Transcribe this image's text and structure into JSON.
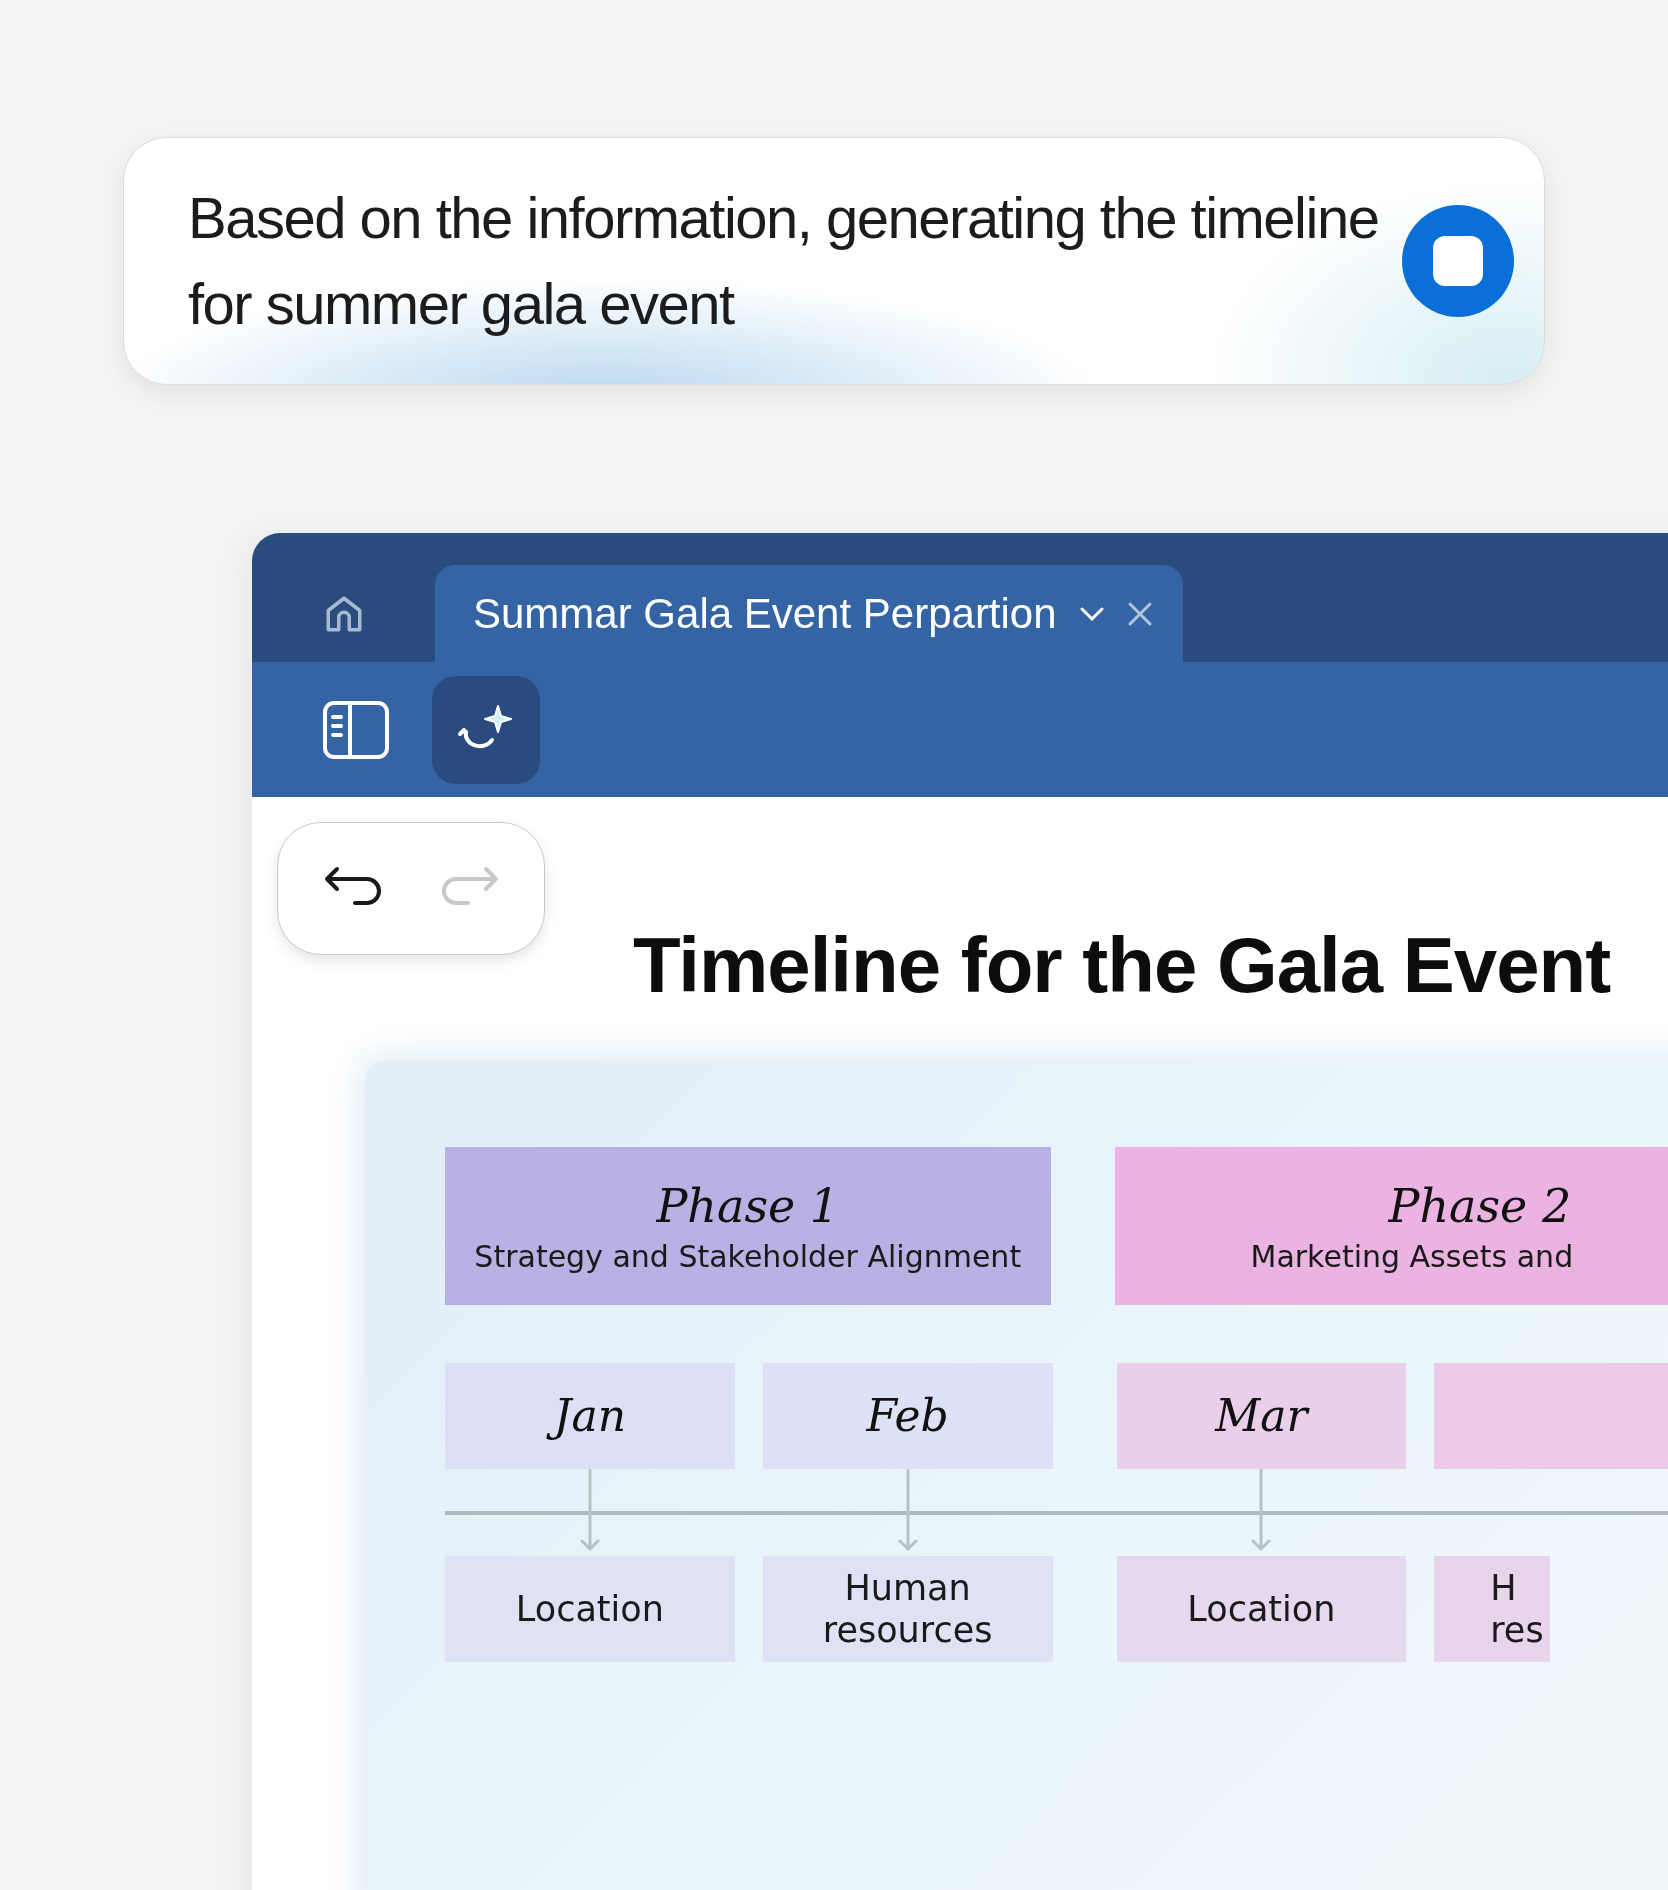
{
  "prompt": {
    "text": "Based on the information, generating the timeline for summer gala event",
    "generating": true
  },
  "tabs": [
    {
      "label": "Summar Gala Event Perpartion",
      "selected": true
    }
  ],
  "history": {
    "undo_disabled": false,
    "redo_disabled": true
  },
  "document": {
    "title": "Timeline for the Gala Event"
  },
  "timeline": {
    "phases": [
      {
        "title": "Phase 1",
        "subtitle": "Strategy and Stakeholder Alignment",
        "color": "#b8b1e3"
      },
      {
        "title": "Phase 2",
        "subtitle": "Marketing Assets and",
        "color": "#eab3e1"
      }
    ],
    "months": [
      {
        "label": "Jan",
        "color": "#dcdff6",
        "item": "Location"
      },
      {
        "label": "Feb",
        "color": "#dde1f6",
        "item": "Human resources"
      },
      {
        "label": "Mar",
        "color": "#eacfea",
        "item": "Location"
      },
      {
        "color": "#ecc9e8",
        "item": "H res"
      }
    ]
  }
}
